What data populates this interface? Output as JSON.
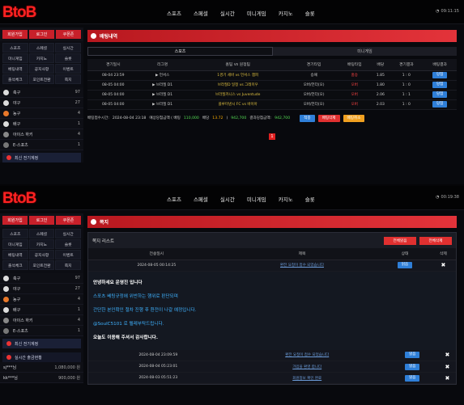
{
  "brand": {
    "logo": "BtoB"
  },
  "nav": [
    "스포츠",
    "스페셜",
    "실시간",
    "미니게임",
    "카지노",
    "슬롯"
  ],
  "clock": "09:11:15",
  "clock2": "00:19:38",
  "side_tabs": [
    "회원가입",
    "로그인",
    "쿠폰존"
  ],
  "side_menu": [
    "스포츠",
    "스페셜",
    "실시간",
    "미니게임",
    "카지노",
    "슬롯",
    "베팅내역",
    "공지사항",
    "이벤트",
    "출석체크",
    "포인트전환",
    "쪽지"
  ],
  "sports": [
    {
      "name": "축구",
      "count": "97"
    },
    {
      "name": "야구",
      "count": "27"
    },
    {
      "name": "농구",
      "count": "4"
    },
    {
      "name": "배구",
      "count": "1"
    },
    {
      "name": "아이스 하키",
      "count": "4"
    },
    {
      "name": "E-스포츠",
      "count": "1"
    }
  ],
  "recent_btn": "최신 전기계정",
  "realtime_title": "실시간 출금현황",
  "withdraw": [
    {
      "user": "sj***님",
      "amount": "1,080,000 원"
    },
    {
      "user": "kk***님",
      "amount": "900,000 원"
    }
  ],
  "bet": {
    "title": "배팅내역",
    "tabs": [
      "스포츠",
      "미니게임"
    ],
    "headers": [
      "경기일시",
      "리그명",
      "홈팀 vs 원정팀",
      "경기타입",
      "배팅타입",
      "배당",
      "경기결과",
      "배팅결과"
    ],
    "rows": [
      {
        "date": "08-04 23:59",
        "league": "▶ 언서스",
        "match": "1경기 세바 vs 언서스 챔피",
        "type": "승패",
        "pick": "홈승",
        "odds": "1.85",
        "score": "1 : 0",
        "result": "당첨"
      },
      {
        "date": "08-05 04:00",
        "league": "▶ 브라질 D1",
        "match": "브라질D 일정 vs 그레미우",
        "type": "오버/언더(오)",
        "pick": "오버",
        "odds": "1.80",
        "score": "1 : 0",
        "result": "당첨"
      },
      {
        "date": "08-05 04:00",
        "league": "▶ 브라질 D1",
        "match": "브라질카니스 vs Juventude",
        "type": "오버/언더(오)",
        "pick": "오버",
        "odds": "2.06",
        "score": "1 : 1",
        "result": "당첨"
      },
      {
        "date": "08-05 04:00",
        "league": "▶ 브라질 D1",
        "match": "플루미넨시 FC vs 바이아",
        "type": "오버/언더(오)",
        "pick": "오버",
        "odds": "2.03",
        "score": "1 : 0",
        "result": "당첨"
      }
    ],
    "summary": {
      "time_label": "배팅접수시간:",
      "time": "2024-08-04 23:18",
      "amt_label": "예상당첨금액 ( 배팅",
      "amt": "110,000",
      "odds_label": "배당",
      "odds": "13.72",
      "exp_label": ")",
      "exp": "942,700",
      "win_label": "결과당첨금액:",
      "win": "942,700"
    },
    "buttons": [
      "적중",
      "배팅삭제",
      "배팅취소"
    ],
    "page": "1"
  },
  "notice": {
    "title": "쪽지",
    "list_label": "쪽지 리스트",
    "btns": [
      "전체읽음",
      "전체삭제"
    ],
    "headers": [
      "전송일시",
      "제목",
      "상태",
      "삭제"
    ],
    "first": {
      "date": "2024-08-05 00:14:25",
      "subject": "환전 요청이 접수 되었습니다",
      "status": "읽음",
      "del": "✖"
    },
    "content": [
      "안녕하세요 운영진 입니다",
      "스포츠 베팅규정에 위반하는 행위로 판단되며",
      "간단한 본인확인 절차 진행 후 환전이 나갈 예정입니다.",
      "@SoulC5101 로 텔레부탁드립니다.",
      "오늘도 이용해 주셔서 감사합니다."
    ],
    "rows": [
      {
        "date": "2024-08-04 23:09:59",
        "subject": "환전 요청이 접수 되었습니다",
        "status": "읽음",
        "del": "✖"
      },
      {
        "date": "2024-08-04 05:23:01",
        "subject": "가입을 환영 합니다",
        "status": "읽음",
        "del": "✖"
      },
      {
        "date": "2024-08-03 05:51:23",
        "subject": "회원정보 확인 완료",
        "status": "읽음",
        "del": "✖"
      }
    ]
  }
}
